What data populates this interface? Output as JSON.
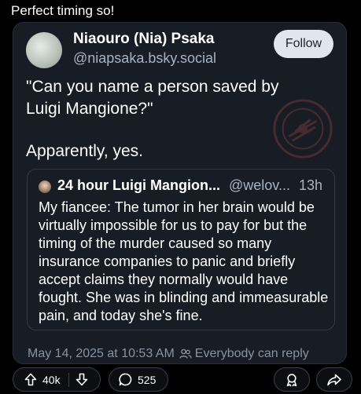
{
  "caption": "Perfect timing so!",
  "post": {
    "author_name": "Niaouro (Nia) Psaka",
    "author_handle": "@niapsaka.bsky.social",
    "follow_label": "Follow",
    "text_line1": "\"Can you name a person saved by Luigi Mangione?\"",
    "text_line2": "Apparently, yes."
  },
  "quote": {
    "author_name": "24 hour Luigi Mangion...",
    "author_handle": "@welov...",
    "time": "13h",
    "body": "My fiancee: The tumor in her brain would be virtually impossible for us to pay for but the timing of the murder caused so many insurance companies to panic and briefly accept claims they normally would have fought. She was in blinding and immeasurable pain, and today she's fine."
  },
  "meta": {
    "timestamp": "May 14, 2025 at 10:53 AM",
    "audience": "Everybody can reply"
  },
  "actions": {
    "upvotes": "40k",
    "comments": "525"
  },
  "icons": [
    "avatar",
    "seal-watermark",
    "people-icon",
    "arrow-up-icon",
    "arrow-down-icon",
    "comment-icon",
    "award-icon",
    "share-icon"
  ]
}
